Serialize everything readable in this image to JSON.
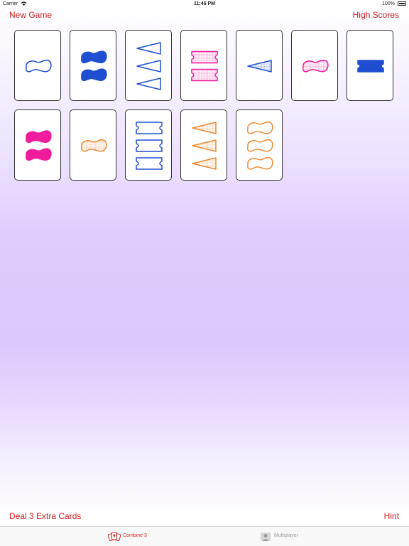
{
  "status_bar": {
    "carrier": "Carrier",
    "time": "11:46 PM",
    "battery": "100%"
  },
  "header": {
    "new_game": "New Game",
    "high_scores": "High Scores"
  },
  "footer": {
    "deal_extra": "Deal 3 Extra Cards",
    "hint": "Hint"
  },
  "tabs": [
    {
      "label": "Combine 3",
      "icon": "combine-3-icon",
      "selected": true
    },
    {
      "label": "Multiplayer",
      "icon": "person-icon",
      "selected": false
    }
  ],
  "colors": {
    "accent": "#d32020",
    "blue": "#1f4fd0",
    "pink": "#f01c9c",
    "orange": "#ee8a34"
  },
  "cards": [
    {
      "count": 1,
      "shape": "squiggle",
      "color": "blue",
      "fill": "outline"
    },
    {
      "count": 2,
      "shape": "squiggle",
      "color": "blue",
      "fill": "solid"
    },
    {
      "count": 3,
      "shape": "triangle",
      "color": "blue",
      "fill": "outline"
    },
    {
      "count": 2,
      "shape": "bowtie",
      "color": "pink",
      "fill": "striped"
    },
    {
      "count": 1,
      "shape": "triangle",
      "color": "blue",
      "fill": "striped"
    },
    {
      "count": 1,
      "shape": "squiggle",
      "color": "pink",
      "fill": "striped"
    },
    {
      "count": 1,
      "shape": "bowtie",
      "color": "blue",
      "fill": "solid"
    },
    {
      "count": 2,
      "shape": "squiggle",
      "color": "pink",
      "fill": "solid"
    },
    {
      "count": 1,
      "shape": "squiggle",
      "color": "orange",
      "fill": "striped"
    },
    {
      "count": 3,
      "shape": "bowtie",
      "color": "blue",
      "fill": "outline"
    },
    {
      "count": 3,
      "shape": "triangle",
      "color": "orange",
      "fill": "striped"
    },
    {
      "count": 3,
      "shape": "squiggle",
      "color": "orange",
      "fill": "outline"
    }
  ]
}
